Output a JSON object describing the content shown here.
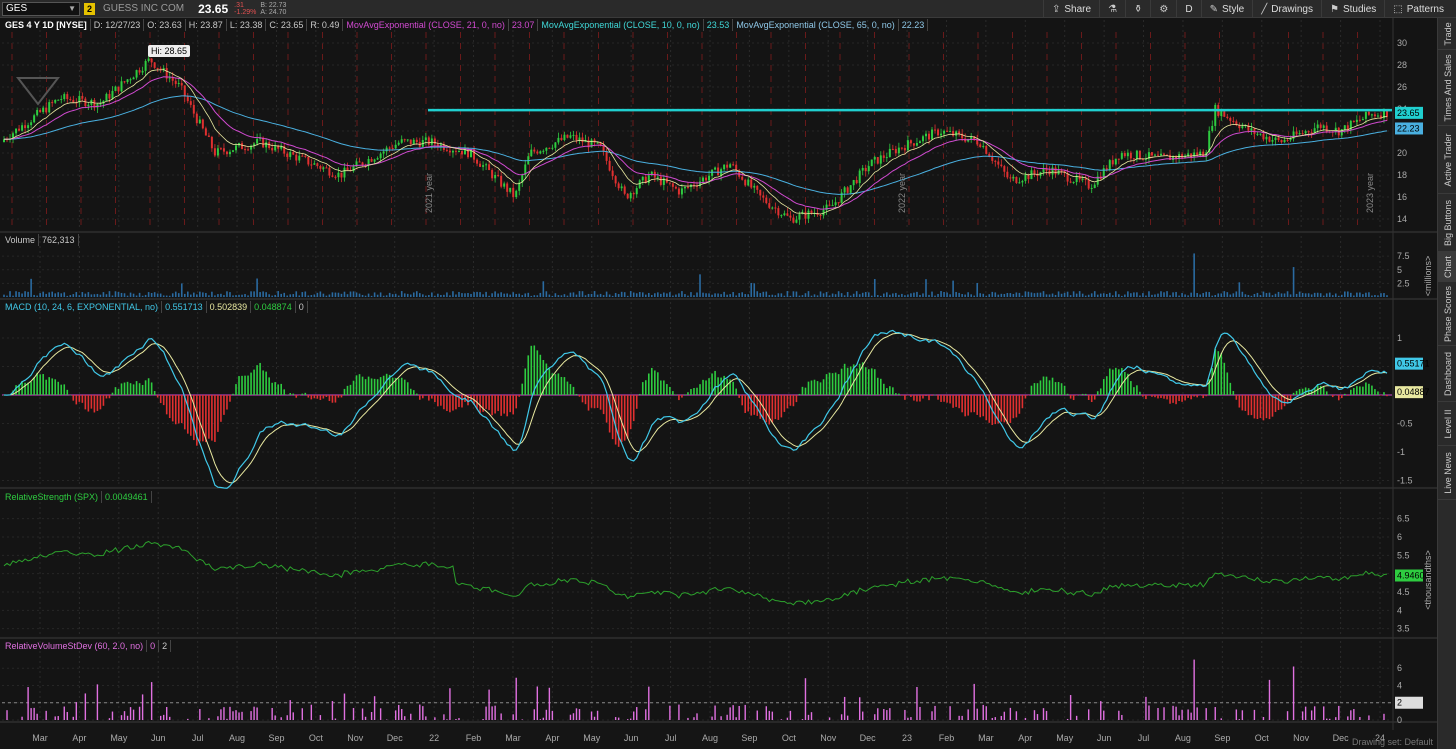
{
  "toolbar": {
    "symbol": "GES",
    "link_badge": "2",
    "company": "GUESS INC COM",
    "last": "23.65",
    "change": ".31",
    "change_pct": "-1.29%",
    "bid": "B: 22.73",
    "ask": "A: 24.70",
    "buttons": [
      {
        "label": "Share",
        "icon": "share-icon"
      },
      {
        "label": "",
        "icon": "flask-icon"
      },
      {
        "label": "",
        "icon": "beaker-icon"
      },
      {
        "label": "",
        "icon": "gear-icon"
      },
      {
        "label": "D",
        "icon": ""
      },
      {
        "label": "Style",
        "icon": "palette-icon"
      },
      {
        "label": "Drawings",
        "icon": "pencil-icon"
      },
      {
        "label": "Studies",
        "icon": "studies-icon"
      },
      {
        "label": "Patterns",
        "icon": "patterns-icon"
      }
    ]
  },
  "side_tabs": [
    "Trade",
    "Times And Sales",
    "Active Trader",
    "Big Buttons",
    "Chart",
    "Phase Scores",
    "Dashboard",
    "Level II",
    "Live News"
  ],
  "price_pane": {
    "title": "GES 4 Y 1D [NYSE]",
    "date": "D: 12/27/23",
    "open": "O: 23.63",
    "high": "H: 23.87",
    "low": "L: 23.38",
    "close": "C: 23.65",
    "range": "R: 0.49",
    "ma1_label": "MovAvgExponential (CLOSE, 21, 0, no)",
    "ma1_value": "23.07",
    "ma2_label": "MovAvgExponential (CLOSE, 10, 0, no)",
    "ma2_value": "23.53",
    "ma3_label": "MovAvgExponential (CLOSE, 65, 0, no)",
    "ma3_value": "22.23",
    "hi_label": "Hi: 28.65",
    "price_tag": "23.65",
    "ma_tag": "22.23",
    "y_ticks": [
      "30",
      "28",
      "26",
      "24",
      "22",
      "20",
      "18",
      "16",
      "14"
    ],
    "year_labels": [
      "2021 year",
      "2022 year",
      "2023 year"
    ]
  },
  "volume_pane": {
    "label": "Volume",
    "value": "762,313",
    "y_ticks": [
      "7.5",
      "5",
      "2.5"
    ],
    "unit": "<millions>"
  },
  "macd_pane": {
    "label": "MACD (10, 24, 6, EXPONENTIAL, no)",
    "value": "0.551713",
    "avg": "0.502839",
    "diff": "0.048874",
    "zero": "0",
    "y_ticks": [
      "1",
      "0.5",
      "0",
      "-0.5",
      "-1",
      "-1.5"
    ],
    "tag_macd": "0.55171",
    "tag_diff": "0.04887"
  },
  "rs_pane": {
    "label": "RelativeStrength (SPX)",
    "value": "0.0049461",
    "y_ticks": [
      "6.5",
      "6",
      "5.5",
      "5",
      "4.5",
      "4",
      "3.5"
    ],
    "tag": "4.94606",
    "unit": "<thousandths>"
  },
  "rv_pane": {
    "label": "RelativeVolumeStDev (60, 2.0, no)",
    "v1": "0",
    "v2": "2",
    "y_ticks": [
      "6",
      "4",
      "2",
      "0"
    ],
    "tag": "2"
  },
  "x_axis": [
    "Mar",
    "Apr",
    "May",
    "Jun",
    "Jul",
    "Aug",
    "Sep",
    "Oct",
    "Nov",
    "Dec",
    "22",
    "Feb",
    "Mar",
    "Apr",
    "May",
    "Jun",
    "Jul",
    "Aug",
    "Sep",
    "Oct",
    "Nov",
    "Dec",
    "23",
    "Feb",
    "Mar",
    "Apr",
    "May",
    "Jun",
    "Jul",
    "Aug",
    "Sep",
    "Oct",
    "Nov",
    "Dec",
    "24"
  ],
  "footer": "Drawing set: Default",
  "colors": {
    "up": "#2ecc40",
    "down": "#e03030",
    "ma21": "#d04ad0",
    "ma10": "#e8e8a0",
    "ma65": "#4ab0e0",
    "resistance": "#20d0d0",
    "macd": "#40c8e8",
    "rs": "#2ca02c",
    "rv": "#e070e0"
  }
}
